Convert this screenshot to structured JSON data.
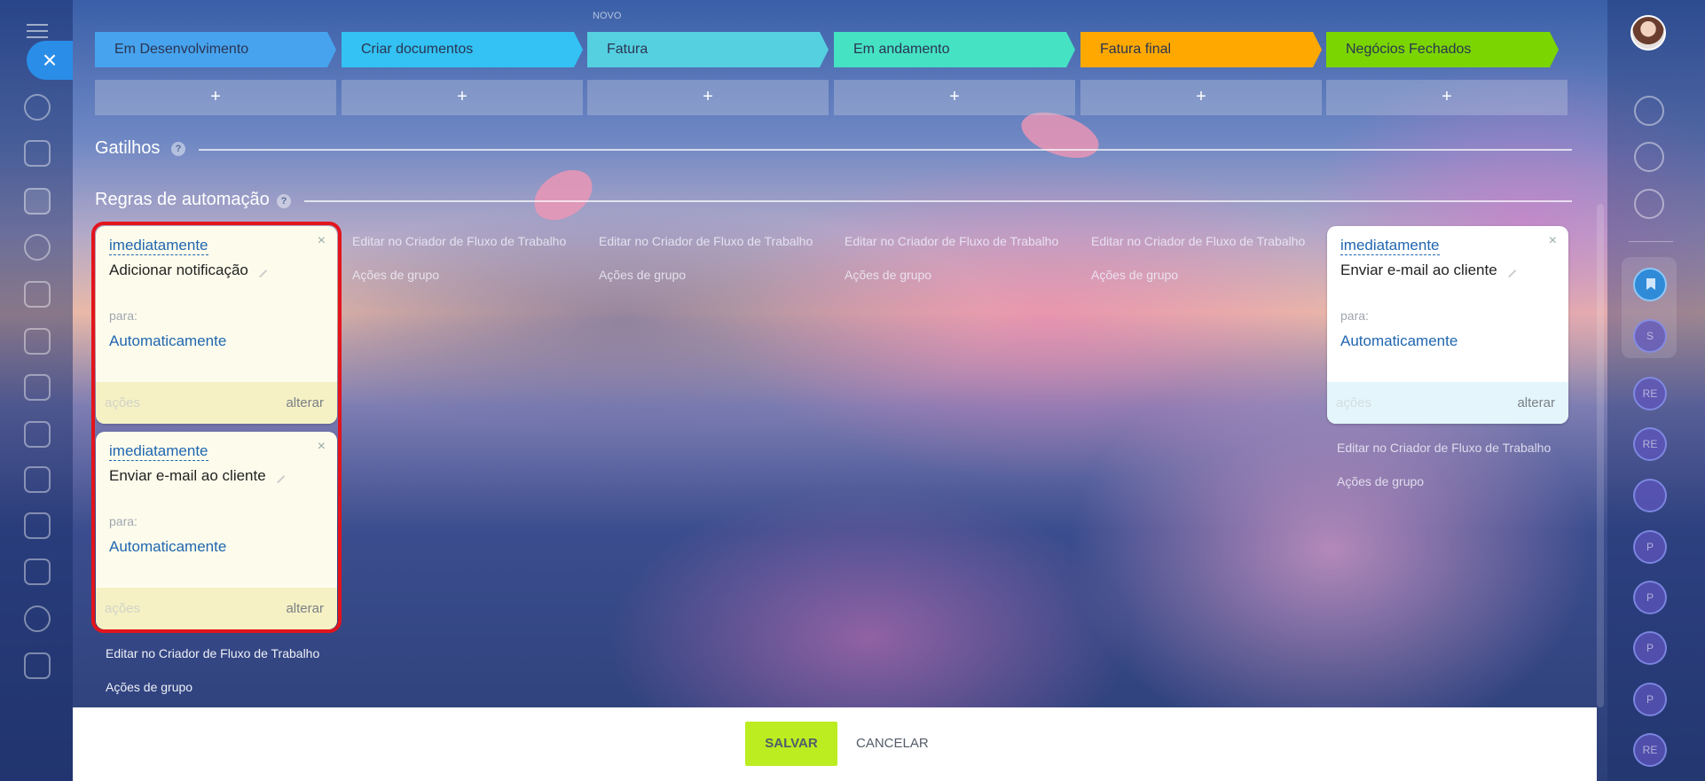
{
  "header": {
    "top_note": "NOVO"
  },
  "stages": [
    {
      "label": "Em Desenvolvimento",
      "color": "#47a3ee"
    },
    {
      "label": "Criar documentos",
      "color": "#33c2f3"
    },
    {
      "label": "Fatura",
      "color": "#55d0e0"
    },
    {
      "label": "Em andamento",
      "color": "#45e2c3"
    },
    {
      "label": "Fatura final",
      "color": "#ffa900"
    },
    {
      "label": "Negócios Fechados",
      "color": "#7bd500"
    }
  ],
  "add_label": "+",
  "triggers": {
    "title": "Gatilhos",
    "help": "?"
  },
  "automation": {
    "title": "Regras de automação",
    "help": "?"
  },
  "rules": [
    {
      "delay": "imediatamente",
      "title": "Adicionar notificação",
      "para_label": "para:",
      "recipient": "Automaticamente",
      "actions_label": "ações",
      "change_label": "alterar",
      "close": "×"
    },
    {
      "delay": "imediatamente",
      "title": "Enviar e-mail ao cliente",
      "para_label": "para:",
      "recipient": "Automaticamente",
      "actions_label": "ações",
      "change_label": "alterar",
      "close": "×"
    },
    {
      "delay": "imediatamente",
      "title": "Enviar e-mail ao cliente",
      "para_label": "para:",
      "recipient": "Automaticamente",
      "actions_label": "ações",
      "change_label": "alterar",
      "close": "×"
    }
  ],
  "column_links": {
    "edit": "Editar no Criador de Fluxo de Trabalho",
    "group": "Ações de grupo"
  },
  "right_nav": {
    "circles": [
      "S",
      "RE",
      "RE",
      "",
      "P",
      "P",
      "P",
      "P",
      "RE"
    ]
  },
  "footer": {
    "save": "SALVAR",
    "cancel": "CANCELAR"
  },
  "colors": {
    "highlight": "#e3141c",
    "save_button": "#bbed21",
    "close_button": "#2a8ee9"
  }
}
